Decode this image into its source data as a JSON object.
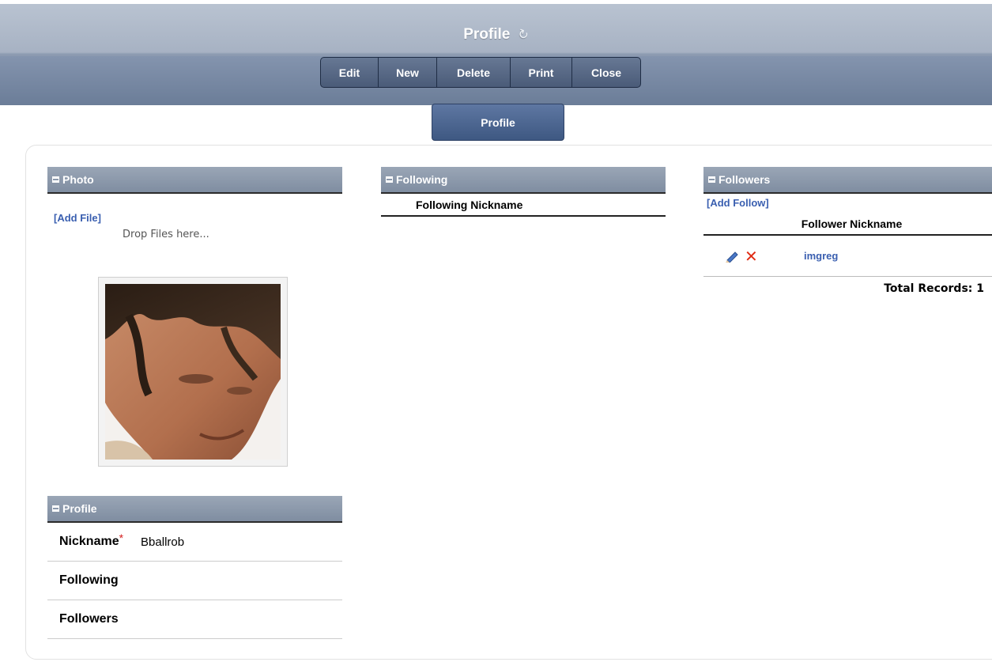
{
  "window": {
    "title": "Profile"
  },
  "toolbar": {
    "buttons": [
      {
        "label": "Edit"
      },
      {
        "label": "New"
      },
      {
        "label": "Delete"
      },
      {
        "label": "Print"
      },
      {
        "label": "Close"
      }
    ]
  },
  "tabs": [
    {
      "label": "Profile",
      "active": true
    }
  ],
  "photo_section": {
    "title": "Photo",
    "add_file_label": "[Add File]",
    "drop_hint": "Drop Files here..."
  },
  "profile_section": {
    "title": "Profile",
    "fields": [
      {
        "label": "Nickname",
        "required_mark": "*",
        "value": "Bballrob"
      },
      {
        "label": "Following",
        "value": ""
      },
      {
        "label": "Followers",
        "value": ""
      }
    ]
  },
  "following_section": {
    "title": "Following",
    "column_header": "Following Nickname"
  },
  "followers_section": {
    "title": "Followers",
    "add_follow_label": "[Add Follow]",
    "column_header": "Follower Nickname",
    "rows": [
      {
        "nickname": "imgreg"
      }
    ],
    "total_records": "Total Records: 1"
  },
  "colors": {
    "header_gradient_top": "#b9c3d1",
    "header_gradient_bottom": "#6e7f99",
    "toolbar_bg": "#4a5b78",
    "tab_bg": "#3e5882",
    "section_header_bg": "#8f9cae",
    "link": "#3a5fb0",
    "delete_red": "#e02c14",
    "required_red": "#d42020"
  },
  "icons": {
    "refresh": "refresh-icon",
    "collapse": "collapse-icon",
    "edit": "pencil-icon",
    "delete": "delete-x-icon"
  }
}
